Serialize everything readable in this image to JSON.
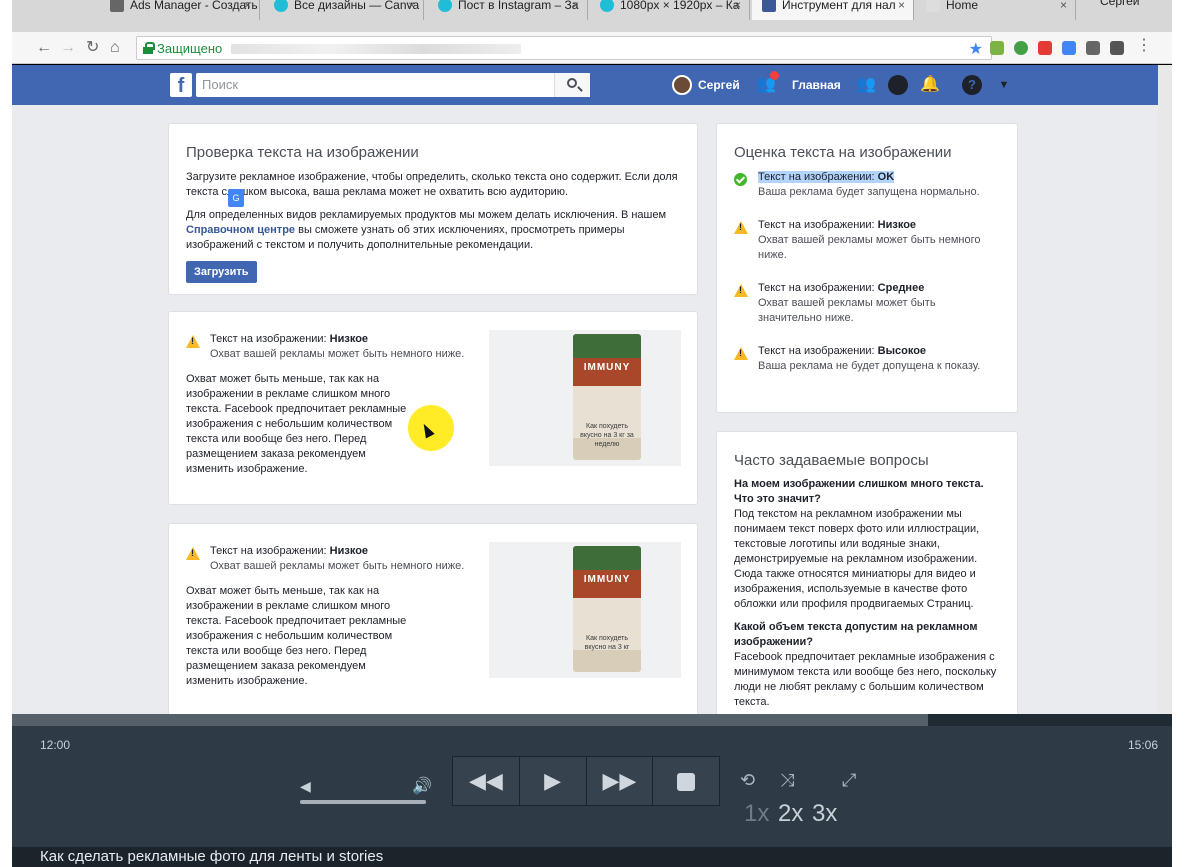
{
  "browser": {
    "tabs": [
      {
        "label": "Ads Manager - Создать"
      },
      {
        "label": "Все дизайны — Canva"
      },
      {
        "label": "Пост в Instagram – За"
      },
      {
        "label": "1080px × 1920px – Ка"
      },
      {
        "label": "Инструмент для нал"
      },
      {
        "label": "Home"
      }
    ],
    "user_badge": "Сергей",
    "secure_label": "Защищено"
  },
  "facebook": {
    "logo": "f",
    "search_placeholder": "Поиск",
    "user_name": "Сергей",
    "home_label": "Главная",
    "help_glyph": "?"
  },
  "check_card": {
    "title": "Проверка текста на изображении",
    "para1": "Загрузите рекламное изображение, чтобы определить, сколько текста оно содержит. Если доля текста слишком высока, ваша реклама может не охватить всю аудиторию.",
    "para2_before": "Для определенных видов рекламируемых продуктов мы можем делать исключения. В нашем ",
    "help_link": "Справочном центре",
    "para2_after": " вы сможете узнать об этих исключениях, просмотреть примеры изображений с текстом и получить дополнительные рекомендации.",
    "upload_button": "Загрузить"
  },
  "results": [
    {
      "prefix": "Текст на изображении: ",
      "level": "Низкое",
      "subtitle": "Охват вашей рекламы может быть немного ниже.",
      "body": "Охват может быть меньше, так как на изображении в рекламе слишком много текста. Facebook предпочитает рекламные изображения с небольшим количеством текста или вообще без него. Перед размещением заказа рекомендуем изменить изображение.",
      "product": "IMMUNY",
      "overlay": "Как похудеть вкусно на 3 кг за неделю"
    },
    {
      "prefix": "Текст на изображении: ",
      "level": "Низкое",
      "subtitle": "Охват вашей рекламы может быть немного ниже.",
      "body": "Охват может быть меньше, так как на изображении в рекламе слишком много текста. Facebook предпочитает рекламные изображения с небольшим количеством текста или вообще без него. Перед размещением заказа рекомендуем изменить изображение.",
      "product": "IMMUNY",
      "overlay": "Как похудеть вкусно на 3 кг"
    }
  ],
  "rating_card": {
    "title": "Оценка текста на изображении",
    "items": [
      {
        "prefix": "Текст на изображении: ",
        "level": "OK",
        "desc": "Ваша реклама будет запущена нормально.",
        "status": "ok"
      },
      {
        "prefix": "Текст на изображении: ",
        "level": "Низкое",
        "desc": "Охват вашей рекламы может быть немного ниже.",
        "status": "warn"
      },
      {
        "prefix": "Текст на изображении: ",
        "level": "Среднее",
        "desc": "Охват вашей рекламы может быть значительно ниже.",
        "status": "warn"
      },
      {
        "prefix": "Текст на изображении: ",
        "level": "Высокое",
        "desc": "Ваша реклама не будет допущена к показу.",
        "status": "warn"
      }
    ]
  },
  "faq_card": {
    "title": "Часто задаваемые вопросы",
    "q1": "На моем изображении слишком много текста. Что это значит?",
    "a1": "Под текстом на рекламном изображении мы понимаем текст поверх фото или иллюстрации, текстовые логотипы или водяные знаки, демонстрируемые на рекламном изображении. Сюда также относятся миниатюры для видео и изображения, используемые в качестве фото обложки или профиля продвигаемых Страниц.",
    "q2": "Какой объем текста допустим на рекламном изображении?",
    "a2": "Facebook предпочитает рекламные изображения с минимумом текста или вообще без него, поскольку люди не любят рекламу с большим количеством текста."
  },
  "player": {
    "current_time": "12:00",
    "total_time": "15:06",
    "progress": 0.79,
    "volume": 1.0,
    "speeds": [
      "1x",
      "2x",
      "3x"
    ],
    "caption": "Как сделать рекламные фото для ленты и stories"
  }
}
